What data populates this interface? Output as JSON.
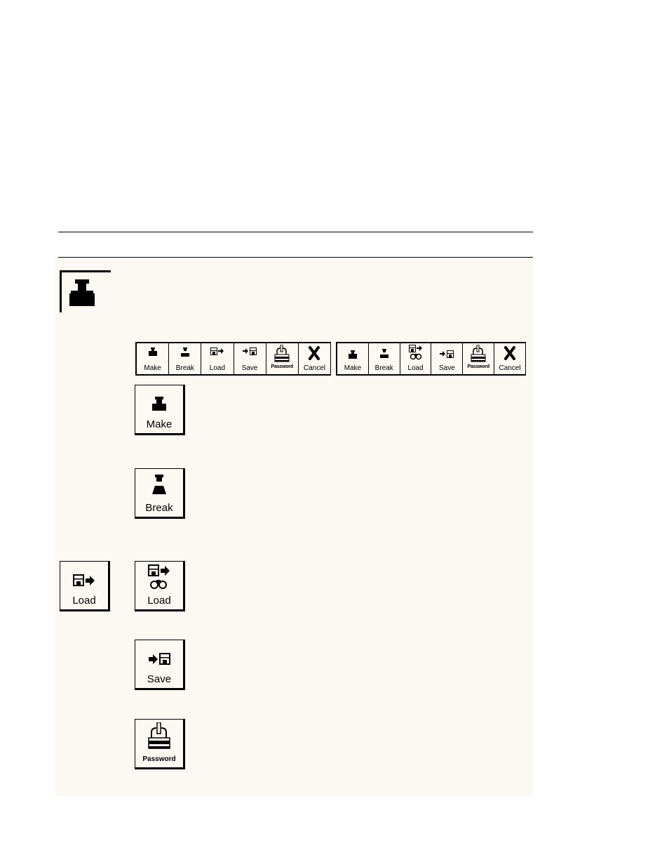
{
  "panel": {
    "background": "#fcf8f2",
    "corner_icon": "make-connection-icon"
  },
  "toolbar_a": {
    "buttons": [
      {
        "label": "Make",
        "icon": "make-icon"
      },
      {
        "label": "Break",
        "icon": "break-icon"
      },
      {
        "label": "Load",
        "icon": "load-icon"
      },
      {
        "label": "Save",
        "icon": "save-icon"
      },
      {
        "label": "Password",
        "icon": "password-lock-icon"
      },
      {
        "label": "Cancel",
        "icon": "cancel-x-icon"
      }
    ]
  },
  "toolbar_b": {
    "buttons": [
      {
        "label": "Make",
        "icon": "make-icon"
      },
      {
        "label": "Break",
        "icon": "break-icon"
      },
      {
        "label": "Load",
        "icon": "load-preview-icon"
      },
      {
        "label": "Save",
        "icon": "save-icon"
      },
      {
        "label": "Password",
        "icon": "password-lock-icon"
      },
      {
        "label": "Cancel",
        "icon": "cancel-x-icon"
      }
    ]
  },
  "buttons": {
    "make": {
      "label": "Make"
    },
    "break": {
      "label": "Break"
    },
    "load_left": {
      "label": "Load"
    },
    "load": {
      "label": "Load"
    },
    "save": {
      "label": "Save"
    },
    "password": {
      "label": "Password"
    }
  }
}
